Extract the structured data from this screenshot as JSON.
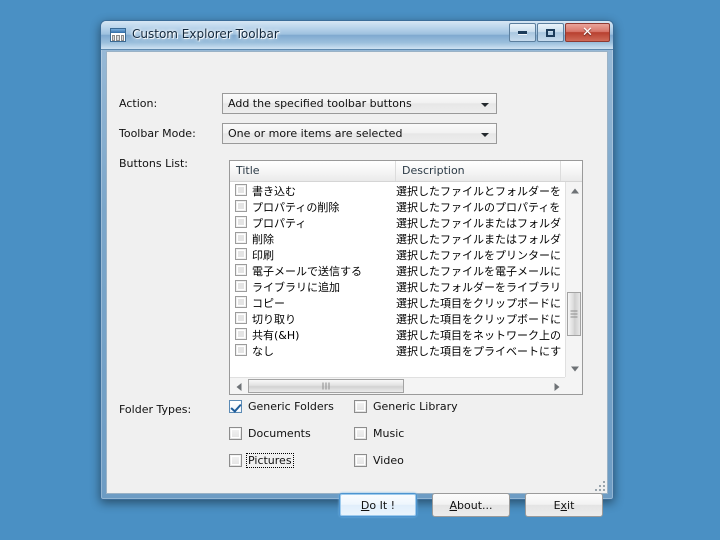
{
  "desktop": {
    "background_color": "#4a90c4"
  },
  "window": {
    "title": "Custom Explorer Toolbar",
    "icon": "toolbar-window-icon",
    "controls": {
      "minimize": "minimize-icon",
      "maximize": "maximize-icon",
      "close": "✕"
    }
  },
  "form": {
    "action": {
      "label": "Action:",
      "value": "Add the specified toolbar buttons"
    },
    "toolbar_mode": {
      "label": "Toolbar Mode:",
      "value": "One or more items are selected"
    },
    "buttons_list": {
      "label": "Buttons List:",
      "columns": [
        "Title",
        "Description"
      ],
      "rows": [
        {
          "checked": false,
          "title": "書き込む",
          "description": "選択したファイルとフォルダーをディスク"
        },
        {
          "checked": false,
          "title": "プロパティの削除",
          "description": "選択したファイルのプロパティを削除し"
        },
        {
          "checked": false,
          "title": "プロパティ",
          "description": "選択したファイルまたはフォルダーのプ"
        },
        {
          "checked": false,
          "title": "削除",
          "description": "選択したファイルまたはフォルダーをご"
        },
        {
          "checked": false,
          "title": "印刷",
          "description": "選択したファイルをプリンターに送信し"
        },
        {
          "checked": false,
          "title": "電子メールで送信する",
          "description": "選択したファイルを電子メールに添付"
        },
        {
          "checked": false,
          "title": "ライブラリに追加",
          "description": "選択したフォルダーをライブラリに追加"
        },
        {
          "checked": false,
          "title": "コピー",
          "description": "選択した項目をクリップボードにコピー"
        },
        {
          "checked": false,
          "title": "切り取り",
          "description": "選択した項目をクリップボードに移動"
        },
        {
          "checked": false,
          "title": "共有(&H)",
          "description": "選択した項目をネットワーク上の他の"
        },
        {
          "checked": false,
          "title": "なし",
          "description": "選択した項目をプライベートにすると、"
        }
      ]
    },
    "folder_types": {
      "label": "Folder Types:",
      "items": [
        {
          "label": "Generic Folders",
          "checked": true,
          "focused": false
        },
        {
          "label": "Generic Library",
          "checked": false,
          "focused": false
        },
        {
          "label": "Documents",
          "checked": false,
          "focused": false
        },
        {
          "label": "Music",
          "checked": false,
          "focused": false
        },
        {
          "label": "Pictures",
          "checked": false,
          "focused": true
        },
        {
          "label": "Video",
          "checked": false,
          "focused": false
        }
      ]
    }
  },
  "buttons": {
    "do_it": {
      "before": "D",
      "accel": "D",
      "text_pre": "",
      "label_a": "D",
      "label_b": "o It !",
      "full": "Do It !"
    },
    "about": {
      "label_a": "A",
      "label_b": "bout...",
      "full": "About..."
    },
    "exit": {
      "label_a": "E",
      "label_b": "xit",
      "full": "Exit",
      "accel_index": 1
    }
  }
}
